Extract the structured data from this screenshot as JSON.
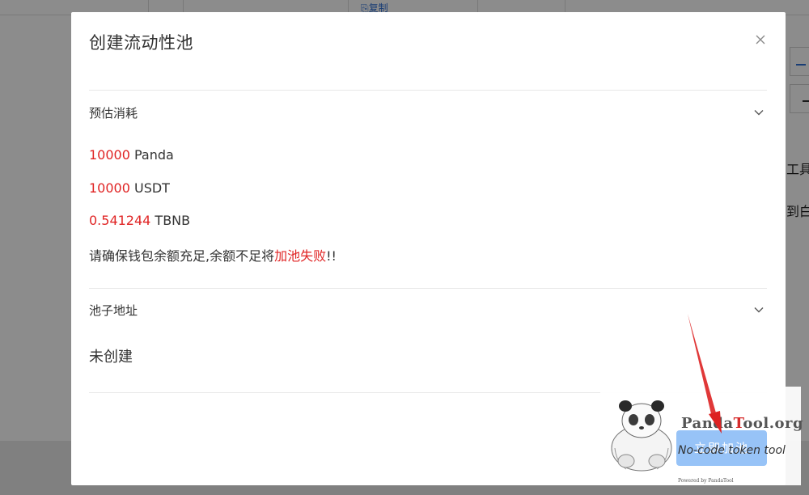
{
  "background": {
    "copy_link": "⎘复制",
    "side_text_1": "工具",
    "side_text_2": "到白"
  },
  "modal": {
    "title": "创建流动性池",
    "close_icon": "close-icon",
    "estimated_cost": {
      "label": "预估消耗",
      "items": [
        {
          "amount": "10000",
          "unit": " Panda"
        },
        {
          "amount": "10000",
          "unit": " USDT"
        },
        {
          "amount": "0.541244",
          "unit": " TBNB"
        }
      ],
      "warning_prefix": "请确保钱包余额充足,余额不足将",
      "warning_red": "加池失败",
      "warning_suffix": "!!"
    },
    "pool_address": {
      "label": "池子地址",
      "status": "未创建"
    },
    "add_button": "立即加池"
  },
  "watermark": {
    "brand_pre": "Panda",
    "brand_accent": "T",
    "brand_post": "ool.org",
    "tagline": "No-code token tool",
    "powered": "Powered by PandaTool"
  },
  "colors": {
    "accent_red": "#e02424",
    "button_blue": "#97c3f7",
    "link_blue": "#2f6fd6"
  }
}
